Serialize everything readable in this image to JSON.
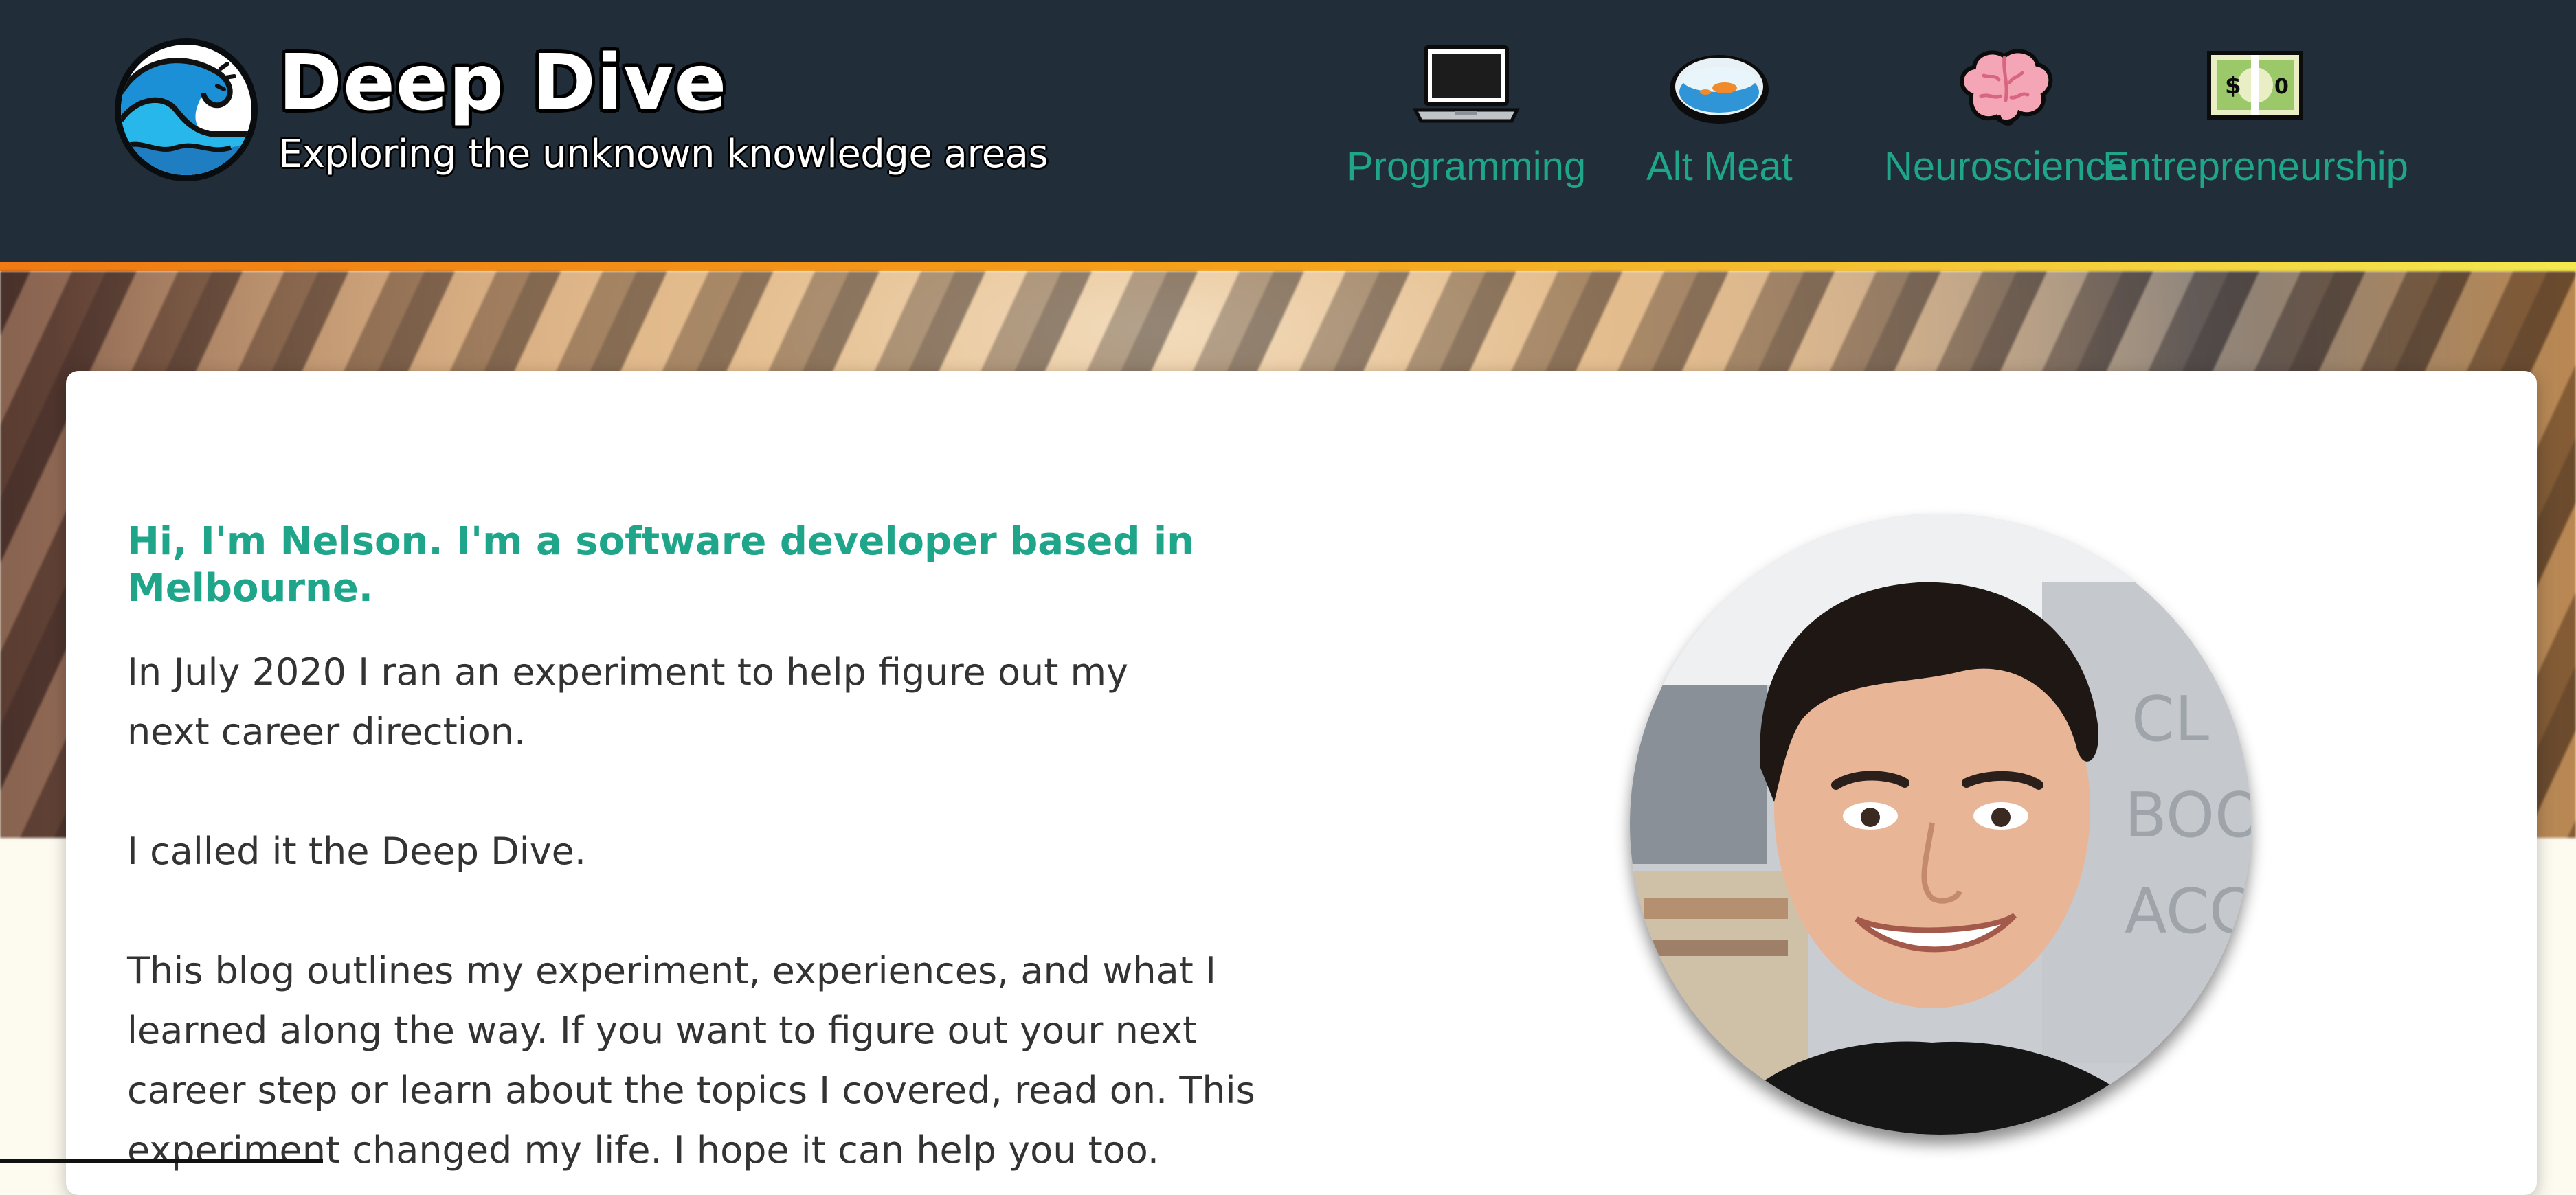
{
  "site": {
    "title": "Deep Dive",
    "tagline": "Exploring the unknown knowledge areas",
    "logo_icon": "wave-icon"
  },
  "nav": {
    "items": [
      {
        "label": "Programming",
        "icon": "laptop-icon"
      },
      {
        "label": "Alt Meat",
        "icon": "petri-dish-icon"
      },
      {
        "label": "Neuroscience",
        "icon": "brain-icon"
      },
      {
        "label": "Entrepreneurship",
        "icon": "dollar-banknote-icon"
      }
    ]
  },
  "intro": {
    "heading": "Hi, I'm Nelson. I'm a software developer based in Melbourne.",
    "paragraphs": [
      "In July 2020 I ran an experiment to help figure out my next career direction.",
      "I called it the Deep Dive.",
      "This blog outlines my experiment, experiences, and what I learned along the way. If you want to figure out your next career step or learn about the topics I covered, read on. This experiment changed my life. I hope it can help you too."
    ],
    "portrait_alt": "portrait-photo"
  },
  "colors": {
    "header_bg": "#212d39",
    "accent": "#1ea58a",
    "header_border_start": "#f07a14",
    "header_border_end": "#f3e94f",
    "page_bg": "#fdfaf0"
  }
}
